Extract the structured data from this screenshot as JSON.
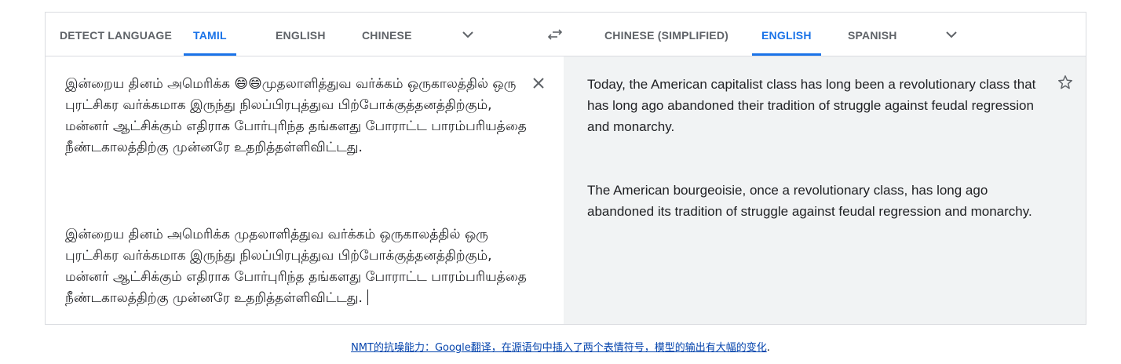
{
  "source_tabs": {
    "detect": "DETECT LANGUAGE",
    "tamil": "TAMIL",
    "english": "ENGLISH",
    "chinese": "CHINESE",
    "active": "TAMIL"
  },
  "target_tabs": {
    "chinese_simplified": "CHINESE (SIMPLIFIED)",
    "english": "ENGLISH",
    "spanish": "SPANISH",
    "active": "ENGLISH"
  },
  "source": {
    "para1": "இன்றைய தினம் அமெரிக்க 😄😄முதலாளித்துவ வர்க்கம் ஒருகாலத்தில் ஒரு புரட்சிகர வர்க்கமாக இருந்து நிலப்பிரபுத்துவ பிற்போக்குத்தனத்திற்கும், மன்னர் ஆட்சிக்கும் எதிராக போர்புரிந்த தங்களது போராட்ட பாரம்பரியத்தை நீண்டகாலத்திற்கு முன்னரே உதறித்தள்ளிவிட்டது.",
    "para2": "இன்றைய தினம் அமெரிக்க முதலாளித்துவ வர்க்கம் ஒருகாலத்தில் ஒரு புரட்சிகர வர்க்கமாக இருந்து நிலப்பிரபுத்துவ பிற்போக்குத்தனத்திற்கும், மன்னர் ஆட்சிக்கும் எதிராக போர்புரிந்த தங்களது போராட்ட பாரம்பரியத்தை நீண்டகாலத்திற்கு முன்னரே உதறித்தள்ளிவிட்டது."
  },
  "target": {
    "para1": "Today, the American capitalist class has long been a revolutionary class that has long ago abandoned their tradition of struggle against feudal regression and monarchy.",
    "para2": "The American bourgeoisie, once a revolutionary class, has long ago abandoned its tradition of struggle against feudal regression and monarchy."
  },
  "caption": {
    "link": "NMT的抗噪能力：Google翻译，在源语句中插入了两个表情符号，模型的输出有大幅的变化",
    "tail": "."
  },
  "icons": {
    "chevron": "chevron-down-icon",
    "swap": "swap-arrows-icon",
    "close": "close-icon",
    "star": "star-outline-icon"
  },
  "colors": {
    "accent": "#1a73e8",
    "tab_inactive": "#5f6368",
    "target_bg": "#f1f3f4",
    "border": "#dadce0",
    "caption_link": "#0645ad"
  }
}
